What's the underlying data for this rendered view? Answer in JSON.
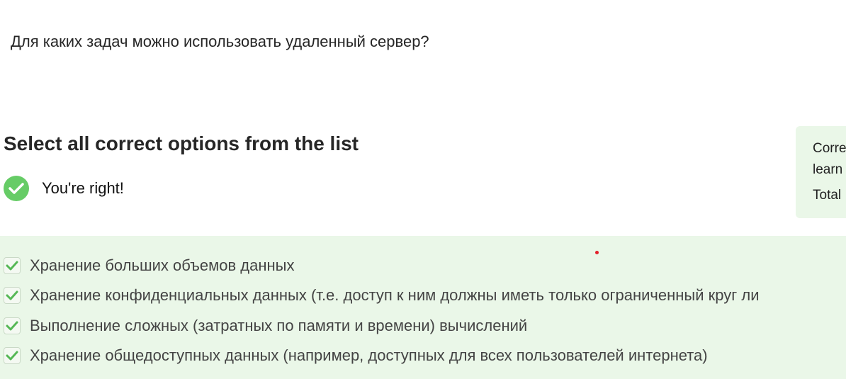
{
  "colors": {
    "accent_green": "#66cc66",
    "panel_green": "#eaf7e8",
    "check_green": "#56b856",
    "marker_red": "#e3202a"
  },
  "question": {
    "text": "Для каких задач можно использовать удаленный сервер?"
  },
  "instruction": {
    "text": "Select all correct options from the list"
  },
  "result": {
    "icon": "check-circle-icon",
    "text": "You're right!"
  },
  "side_panel": {
    "lines": [
      "Corre",
      "learn",
      "Total"
    ]
  },
  "options": [
    {
      "label": "Хранение больших объемов данных",
      "checked": true
    },
    {
      "label": "Хранение конфиденциальных данных (т.е. доступ к ним должны иметь только ограниченный круг ли",
      "checked": true
    },
    {
      "label": "Выполнение сложных (затратных по памяти и времени) вычислений",
      "checked": true
    },
    {
      "label": "Хранение общедоступных данных (например, доступных для всех пользователей интернета)",
      "checked": true
    }
  ]
}
